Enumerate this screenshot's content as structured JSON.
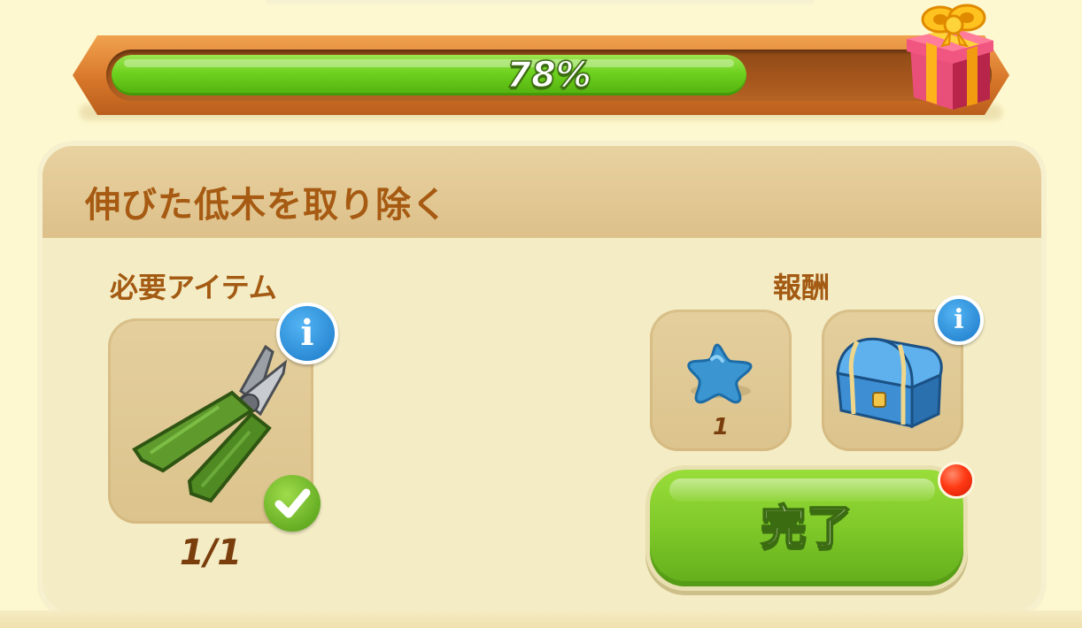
{
  "progress": {
    "value": 0.78,
    "label": "78%"
  },
  "task": {
    "title": "伸びた低木を取り除く"
  },
  "required": {
    "label": "必要アイテム",
    "item_icon": "pruning-shears-icon",
    "count": "1/1",
    "completed": true
  },
  "rewards": {
    "label": "報酬",
    "items": [
      {
        "icon": "blue-star-icon",
        "count": "1"
      },
      {
        "icon": "treasure-chest-icon",
        "count": ""
      }
    ]
  },
  "complete_button": {
    "label": "完了",
    "has_notification": true
  },
  "colors": {
    "background": "#fdf8cf",
    "accent_orange": "#d8772a",
    "progress_green": "#6ed11e",
    "button_green": "#7fc929",
    "title_brown": "#a65a12",
    "info_blue": "#1b79c8"
  }
}
